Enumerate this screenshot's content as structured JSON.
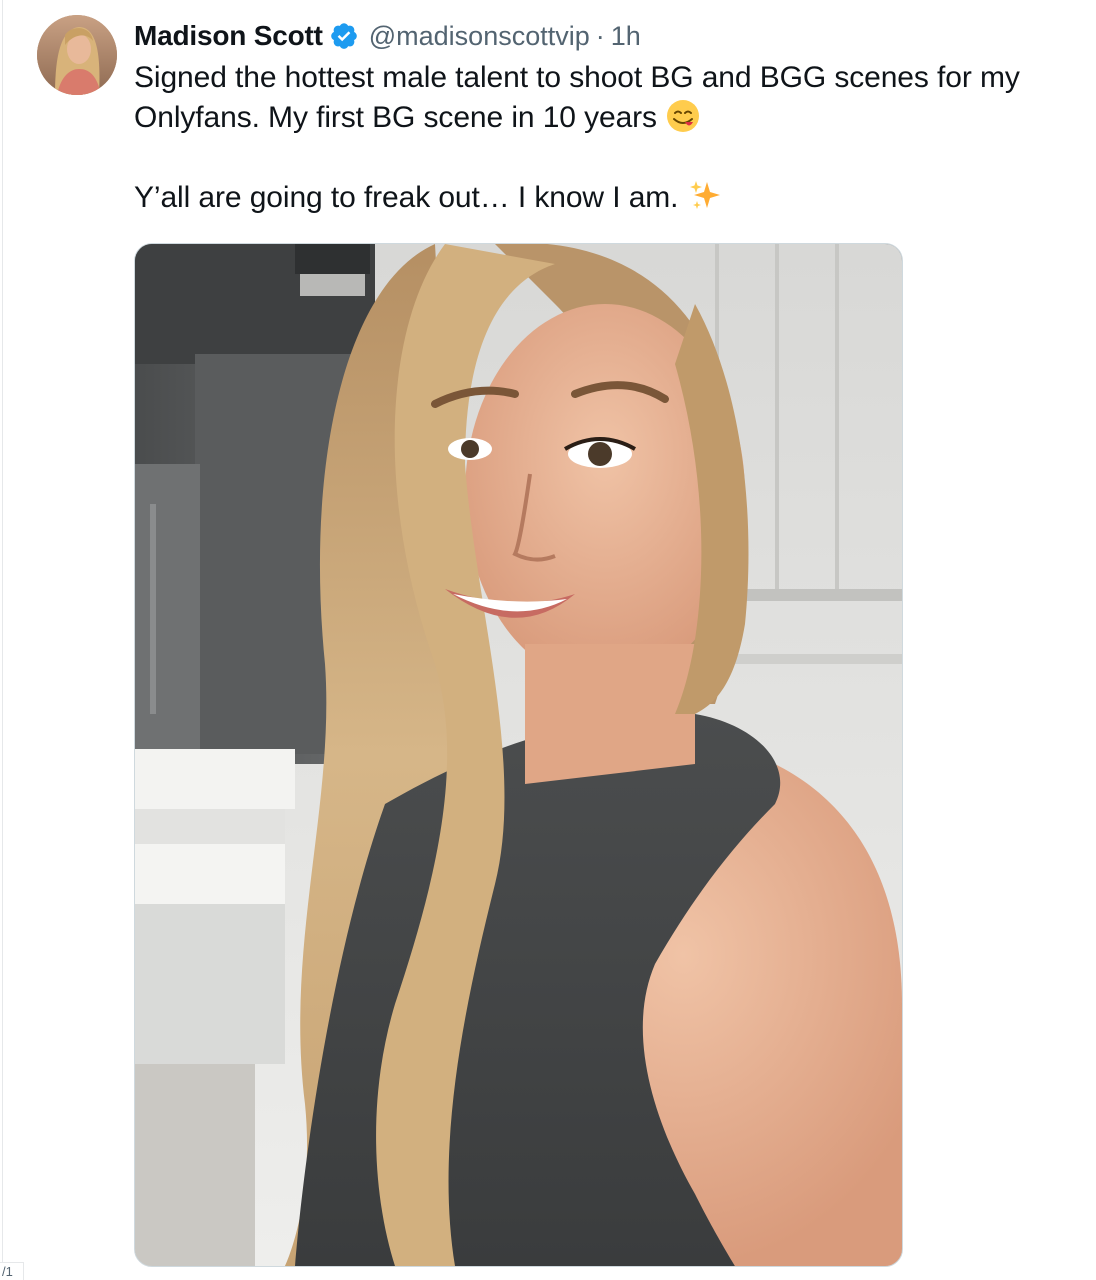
{
  "tweet": {
    "author": {
      "display_name": "Madison Scott",
      "handle": "@madisonscottvip",
      "verified": true,
      "verified_icon": "verified-badge-icon",
      "avatar_icon": "avatar-photo"
    },
    "separator": "·",
    "time": "1h",
    "text_lines": [
      "Signed the hottest male talent to shoot BG and BGG scenes for my",
      "Onlyfans. My first BG scene in 10 years ",
      "",
      "Y’all are going to freak out… I know I am. "
    ],
    "emojis": [
      "face-savoring-food-emoji",
      "sparkles-emoji"
    ],
    "media": {
      "type": "photo",
      "description_icon": "tweet-photo"
    }
  },
  "corner_label": "/1",
  "colors": {
    "text_primary": "#0f1419",
    "text_secondary": "#536471",
    "verified_blue": "#1d9bf0",
    "border": "#cfd9de"
  }
}
